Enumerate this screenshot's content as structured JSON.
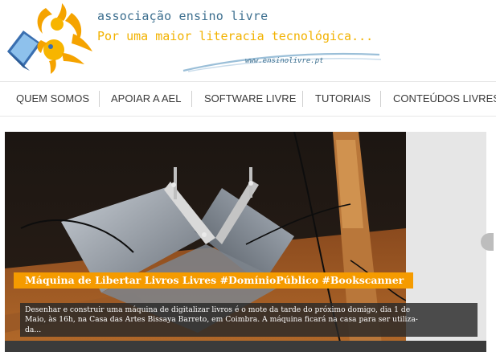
{
  "header": {
    "site_title": "associação ensino livre",
    "tagline": "Por uma maior literacia tecnológica...",
    "url": "www.ensinolivre.pt",
    "icons": [
      "laptop-icon",
      "sun-figure-icon"
    ],
    "colors": {
      "title": "#3d6f8f",
      "tagline": "#f2b200",
      "logo_blue": "#3a6fb0",
      "logo_orange": "#f5a300"
    }
  },
  "nav": {
    "items": [
      {
        "label": "QUEM SOMOS"
      },
      {
        "label": "APOIAR A AEL"
      },
      {
        "label": "SOFTWARE LIVRE"
      },
      {
        "label": "TUTORIAIS"
      },
      {
        "label": "CONTEÚDOS LIVRES"
      }
    ]
  },
  "slider": {
    "title": "Máquina de Libertar Livros Livres #DomínioPúblico #Bookscanner",
    "excerpt_lines": [
      "Desenhar e construir uma máquina de digitalizar livros é o mote da tarde do próximo domigo, dia 1 de",
      "Maio, às 16h, na Casa das Artes Bissaya Barreto, em Coimbra. A máquina ficará na casa para ser utiliza-",
      "da..."
    ],
    "colors": {
      "title_bg": "#f59b00",
      "excerpt_bg": "#282828"
    },
    "icons": [
      "slider-next-arrow"
    ]
  }
}
